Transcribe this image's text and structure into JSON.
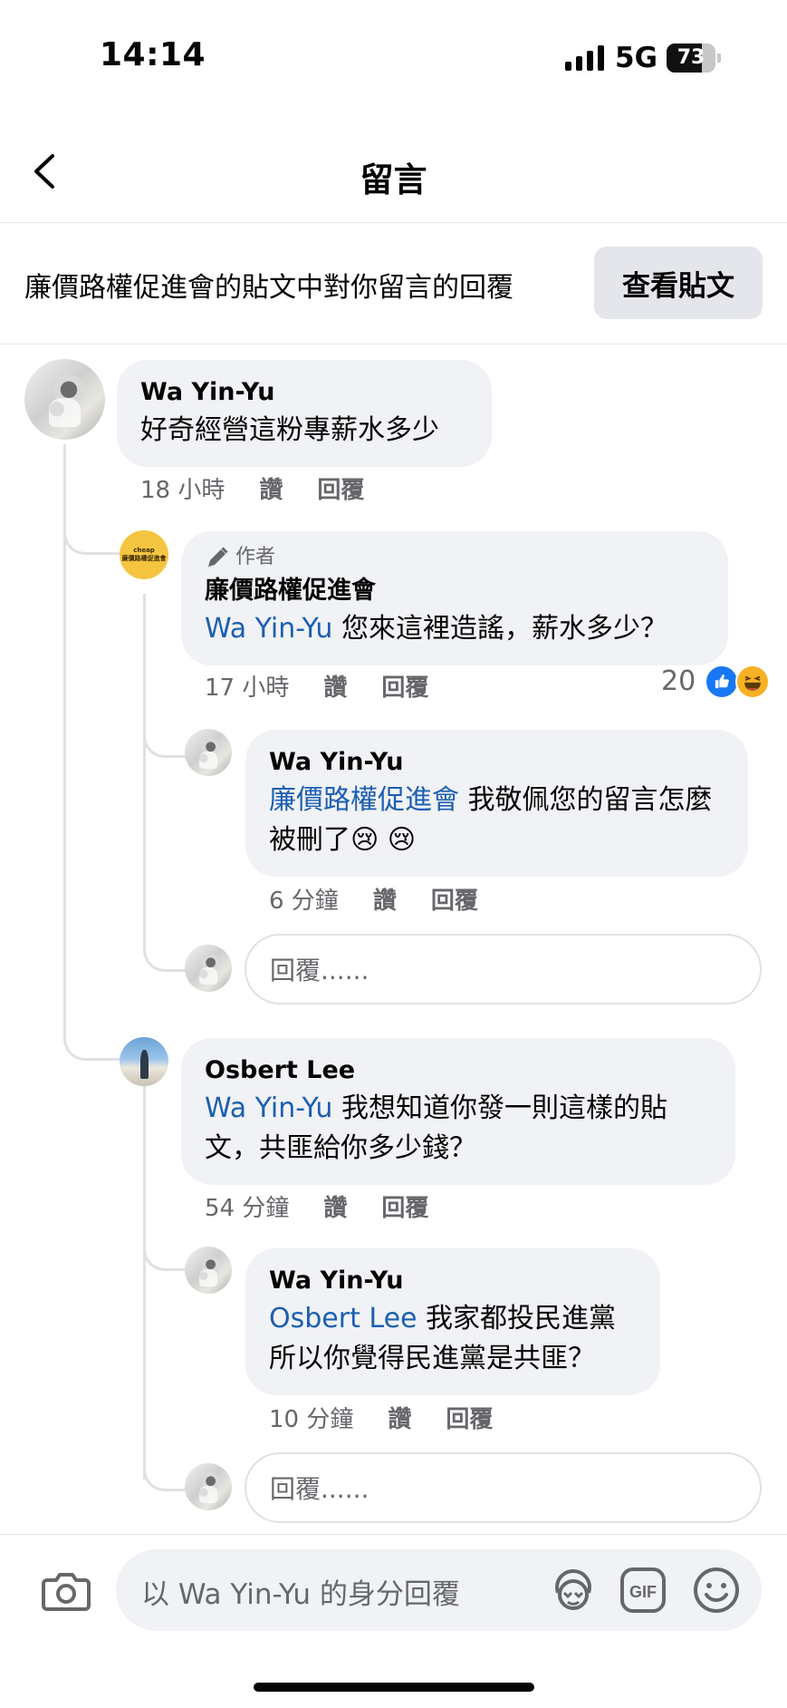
{
  "status_bar": {
    "time": "14:14",
    "network": "5G",
    "battery": "73",
    "battery_level": 0.73
  },
  "header": {
    "title": "留言"
  },
  "context": {
    "text": "廉價路權促進會的貼文中對你留言的回覆",
    "view_post_label": "查看貼文"
  },
  "comments": {
    "c1": {
      "name": "Wa Yin-Yu",
      "text": "好奇經營這粉專薪水多少",
      "time": "18 小時",
      "like": "讚",
      "reply": "回覆"
    },
    "c2": {
      "badge": "作者",
      "name": "廉價路權促進會",
      "mention": "Wa Yin-Yu",
      "text": " 您來這裡造謠，薪水多少？",
      "time": "17 小時",
      "like": "讚",
      "reply": "回覆",
      "reactions": "20",
      "avatar_text": [
        "cheap",
        "廉價路權促進會"
      ]
    },
    "c3": {
      "name": "Wa Yin-Yu",
      "mention": "廉價路權促進會",
      "text": " 我敬佩您的留言怎麼被刪了😢 😢",
      "time": "6 分鐘",
      "like": "讚",
      "reply": "回覆"
    },
    "c4": {
      "name": "Osbert Lee",
      "mention": "Wa Yin-Yu",
      "text": " 我想知道你發一則這樣的貼文，共匪給你多少錢？",
      "time": "54 分鐘",
      "like": "讚",
      "reply": "回覆"
    },
    "c5": {
      "name": "Wa Yin-Yu",
      "mention": "Osbert Lee",
      "text": " 我家都投民進黨 所以你覺得民進黨是共匪？",
      "time": "10 分鐘",
      "like": "讚",
      "reply": "回覆"
    }
  },
  "reply_placeholder": "回覆......",
  "composer": {
    "placeholder": "以 Wa Yin-Yu 的身分回覆"
  },
  "colors": {
    "mention": "#1c5fb0",
    "bubble": "#f0f2f5",
    "like": "#1877f2"
  }
}
